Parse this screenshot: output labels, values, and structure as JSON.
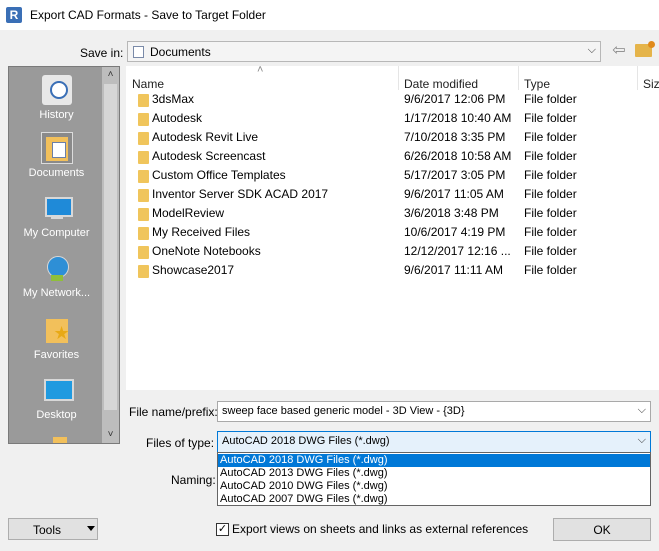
{
  "window": {
    "title": "Export CAD Formats - Save to Target Folder",
    "app_icon_letter": "R"
  },
  "save_in": {
    "label": "Save in:",
    "value": "Documents"
  },
  "places": [
    {
      "label": "History",
      "icon": "history-icon"
    },
    {
      "label": "Documents",
      "icon": "documents-icon"
    },
    {
      "label": "My Computer",
      "icon": "my-computer-icon"
    },
    {
      "label": "My Network...",
      "icon": "network-icon"
    },
    {
      "label": "Favorites",
      "icon": "favorites-icon"
    },
    {
      "label": "Desktop",
      "icon": "desktop-icon"
    }
  ],
  "columns": {
    "name": "Name",
    "date": "Date modified",
    "type": "Type",
    "size": "Siz"
  },
  "files": [
    {
      "name": "3dsMax",
      "date": "9/6/2017 12:06 PM",
      "type": "File folder"
    },
    {
      "name": "Autodesk",
      "date": "1/17/2018 10:40 AM",
      "type": "File folder"
    },
    {
      "name": "Autodesk Revit Live",
      "date": "7/10/2018 3:35 PM",
      "type": "File folder"
    },
    {
      "name": "Autodesk Screencast",
      "date": "6/26/2018 10:58 AM",
      "type": "File folder"
    },
    {
      "name": "Custom Office Templates",
      "date": "5/17/2017 3:05 PM",
      "type": "File folder"
    },
    {
      "name": "Inventor Server SDK ACAD 2017",
      "date": "9/6/2017 11:05 AM",
      "type": "File folder"
    },
    {
      "name": "ModelReview",
      "date": "3/6/2018 3:48 PM",
      "type": "File folder"
    },
    {
      "name": "My Received Files",
      "date": "10/6/2017 4:19 PM",
      "type": "File folder"
    },
    {
      "name": "OneNote Notebooks",
      "date": "12/12/2017 12:16 ...",
      "type": "File folder"
    },
    {
      "name": "Showcase2017",
      "date": "9/6/2017 11:11 AM",
      "type": "File folder"
    }
  ],
  "file_name": {
    "label": "File name/prefix:",
    "value": "sweep face based generic model - 3D View - {3D}"
  },
  "file_type": {
    "label": "Files of type:",
    "value": "AutoCAD 2018 DWG Files  (*.dwg)",
    "options": [
      "AutoCAD 2018 DWG Files  (*.dwg)",
      "AutoCAD 2013 DWG Files  (*.dwg)",
      "AutoCAD 2010 DWG Files  (*.dwg)",
      "AutoCAD 2007 DWG Files  (*.dwg)"
    ]
  },
  "naming": {
    "label": "Naming:"
  },
  "tools_label": "Tools",
  "export_checkbox": {
    "label": "Export views on sheets and links as external references",
    "checked": true,
    "mark": "✓"
  },
  "ok_label": "OK",
  "colors": {
    "selection": "#0078d7",
    "places_panel": "#9a9a9a",
    "folder": "#f0c55c"
  }
}
